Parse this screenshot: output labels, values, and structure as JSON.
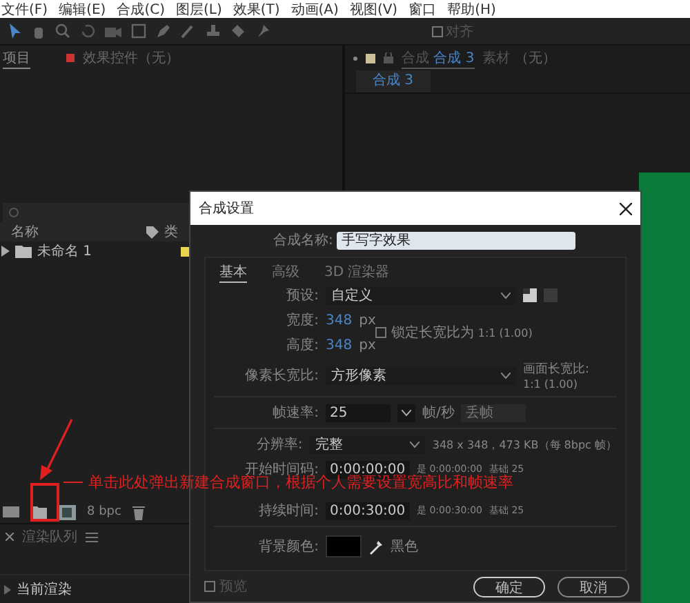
{
  "menu_bar": [
    "文件(F)",
    "编辑(E)",
    "合成(C)",
    "图层(L)",
    "效果(T)",
    "动画(A)",
    "视图(V)",
    "窗口",
    "帮助(H)"
  ],
  "toolbar": {
    "snap_label": "对齐",
    "snap_checked": false
  },
  "project_panel": {
    "tabs": [
      {
        "label": "项目",
        "selected": true
      },
      {
        "label": "效果控件（无）",
        "selected": false
      }
    ],
    "columns": [
      "名称",
      "类"
    ],
    "items": [
      {
        "name": "未命名 1",
        "color": "#e8d44d"
      }
    ],
    "bit_depth": "8 bpc"
  },
  "render_queue": {
    "title": "渲染队列",
    "section": "当前渲染"
  },
  "viewer": {
    "tabs": [
      {
        "prefix": "合成",
        "label": "合成 3",
        "selected": true
      },
      {
        "prefix": "素材",
        "label": "（无）",
        "selected": false
      }
    ],
    "subtab": "合成 3"
  },
  "dialog": {
    "title": "合成设置",
    "name_label": "合成名称:",
    "name_value": "手写字效果",
    "tabs": [
      {
        "label": "基本",
        "selected": true
      },
      {
        "label": "高级",
        "selected": false
      },
      {
        "label": "3D 渲染器",
        "selected": false
      }
    ],
    "preset_label": "预设:",
    "preset_value": "自定义",
    "width_label": "宽度:",
    "width_value": "348",
    "width_unit": "px",
    "height_label": "高度:",
    "height_value": "348",
    "height_unit": "px",
    "lock_label": "锁定长宽比为",
    "lock_value": "1:1 (1.00)",
    "lock_checked": false,
    "pixel_label": "像素长宽比:",
    "pixel_value": "方形像素",
    "frame_ratio_label": "画面长宽比:",
    "frame_ratio_value": "1:1 (1.00)",
    "fps_label": "帧速率:",
    "fps_value": "25",
    "fps_unit": "帧/秒",
    "drop_frame": "丢帧",
    "res_label": "分辨率:",
    "res_value": "完整",
    "res_info": "348 x 348，473 KB（每 8bpc 帧）",
    "times": [
      {
        "label": "开始时间码:",
        "value": "0:00:00:00",
        "equals": "是 0:00:00:00",
        "base": "基础 25"
      },
      {
        "label": "持续时间:",
        "value": "0:00:30:00",
        "equals": "是 0:00:30:00",
        "base": "基础 25"
      }
    ],
    "bg_label": "背景颜色:",
    "bg_name": "黑色",
    "preview_label": "预览",
    "preview_checked": false,
    "buttons": [
      "确定",
      "取消"
    ]
  },
  "annotation": {
    "text": "单击此处弹出新建合成窗口，根据个人需要设置宽高比和帧速率"
  }
}
